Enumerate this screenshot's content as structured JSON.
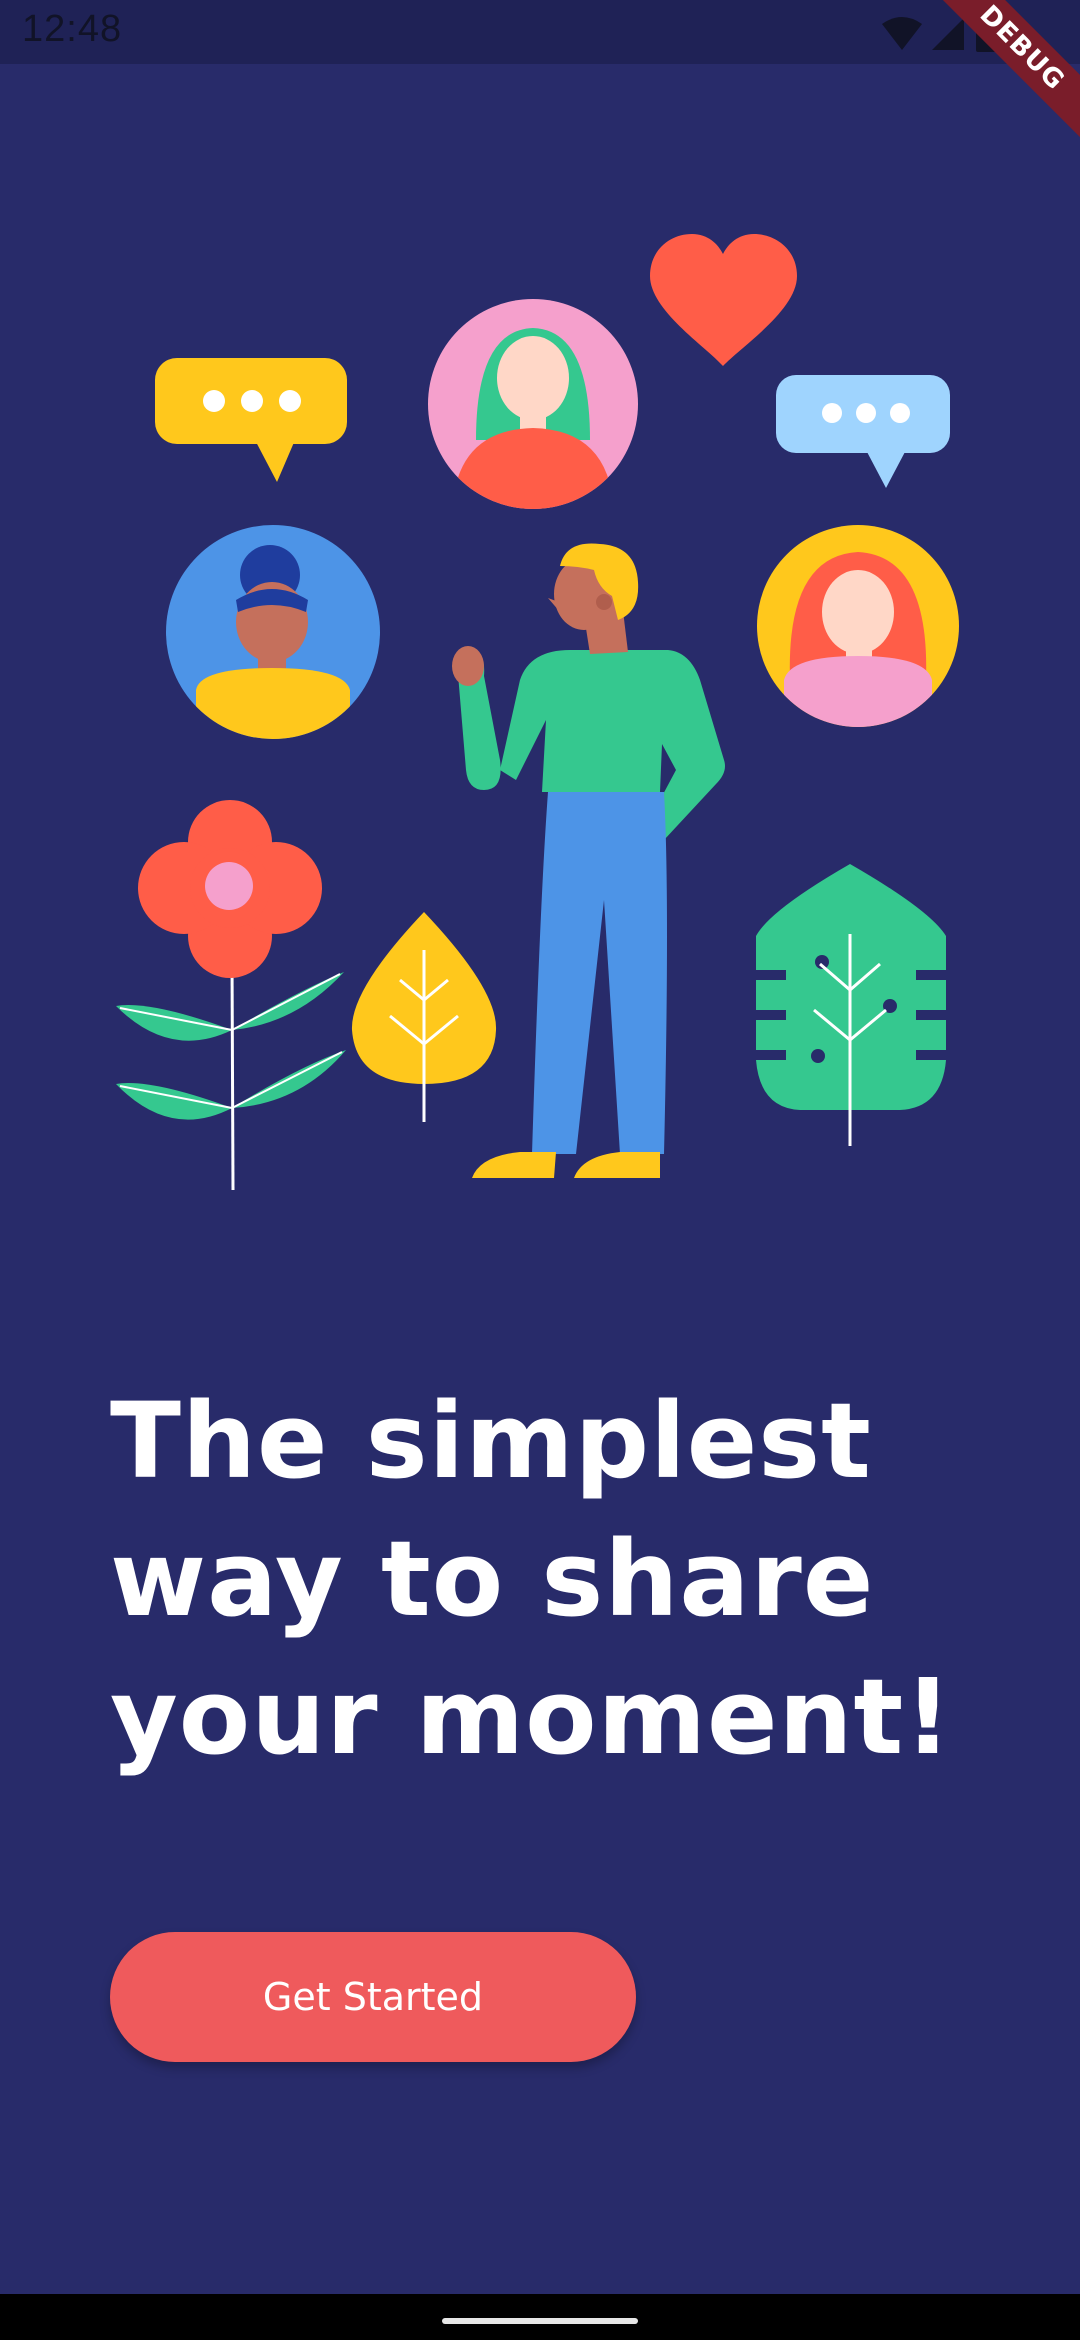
{
  "status_bar": {
    "time": "12:48",
    "icons": [
      "wifi-icon",
      "cellular-signal-icon",
      "battery-icon"
    ]
  },
  "debug_banner": {
    "label": "DEBUG"
  },
  "illustration": {
    "elements": [
      "speech-bubble-yellow",
      "speech-bubble-blue",
      "heart",
      "avatar-green-hair",
      "avatar-blue-bun",
      "avatar-red-hair",
      "waving-person",
      "flower",
      "yellow-leaf",
      "monstera-leaf"
    ]
  },
  "headline": {
    "line1": "The simplest",
    "line2": "way to share",
    "line3": "your moment!"
  },
  "cta": {
    "label": "Get Started"
  },
  "colors": {
    "background": "#282b6a",
    "accent": "#ef5a5c",
    "text": "#ffffff"
  }
}
